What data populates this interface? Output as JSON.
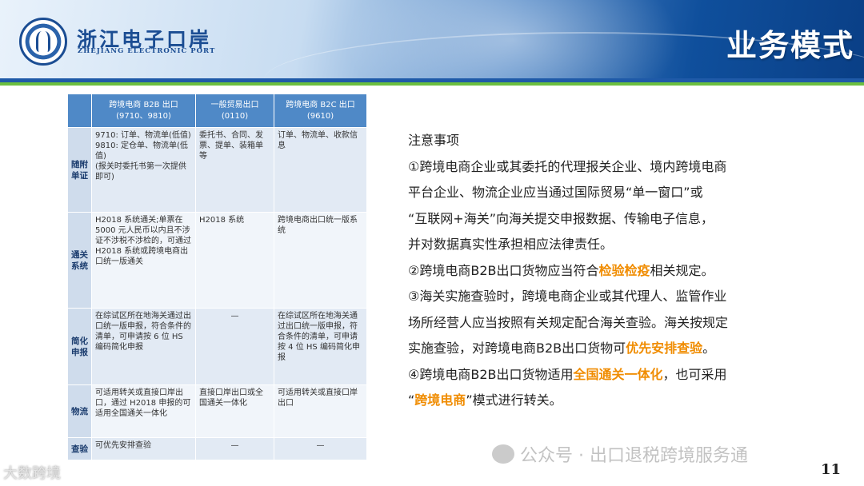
{
  "header": {
    "logo_cn": "浙江电子口岸",
    "logo_en": "ZHEJIANG ELECTRONIC PORT",
    "title": "业务模式"
  },
  "table": {
    "columns": [
      {
        "name": "跨境电商 B2B 出口",
        "code": "(9710、9810)"
      },
      {
        "name": "一般贸易出口",
        "code": "(0110)"
      },
      {
        "name": "跨境电商 B2C 出口",
        "code": "(9610)"
      }
    ],
    "rows": [
      {
        "label": "随附单证",
        "cells": [
          "9710: 订单、物流单(低值)\n9810: 定仓单、物流单(低值)\n(报关时委托书第一次提供即可)",
          "委托书、合同、发票、提单、装箱单等",
          "订单、物流单、收款信息"
        ]
      },
      {
        "label": "通关系统",
        "cells": [
          "H2018 系统通关;单票在 5000 元人民币以内且不涉证不涉税不涉检的，可通过 H2018 系统或跨境电商出口统一版通关",
          "H2018 系统",
          "跨境电商出口统一版系统"
        ]
      },
      {
        "label": "简化申报",
        "cells": [
          "在综试区所在地海关通过出口统一版申报，符合条件的清单，可申请按 6 位 HS 编码简化申报",
          "—",
          "在综试区所在地海关通过出口统一版申报，符合条件的清单，可申请按 4 位 HS 编码简化申报"
        ]
      },
      {
        "label": "物流",
        "cells": [
          "可适用转关或直接口岸出口，通过 H2018 申报的可适用全国通关一体化",
          "直接口岸出口或全国通关一体化",
          "可适用转关或直接口岸出口"
        ]
      },
      {
        "label": "查验",
        "cells": [
          "可优先安排查验",
          "—",
          "—"
        ]
      }
    ]
  },
  "notes": {
    "title": "注意事项",
    "p1": [
      "①跨境电商企业或其委托的代理报关企业、境内跨境电商",
      "平台企业、物流企业应当通过国际贸易“单一窗口”或",
      "“互联网+海关”向海关提交申报数据、传输电子信息，",
      "并对数据真实性承担相应法律责任。"
    ],
    "p2_pre": "②跨境电商B2B出口货物应当符合",
    "p2_hl": "检验检疫",
    "p2_post": "相关规定。",
    "p3_lines": [
      "③海关实施查验时，跨境电商企业或其代理人、监管作业",
      "场所经营人应当按照有关规定配合海关查验。海关按规定"
    ],
    "p3_last_pre": "实施查验，对跨境电商B2B出口货物可",
    "p3_hl": "优先安排查验",
    "p3_post": "。",
    "p4_pre": "④跨境电商B2B出口货物适用",
    "p4_hl": "全国通关一体化",
    "p4_post": "，也可采用",
    "p4b_pre": "“",
    "p4b_hl": "跨境电商",
    "p4b_post": "”模式进行转关。"
  },
  "footer": {
    "page_number": "11",
    "watermark_right": "公众号 · 出口退税跨境服务通",
    "watermark_left": "大数跨境"
  }
}
